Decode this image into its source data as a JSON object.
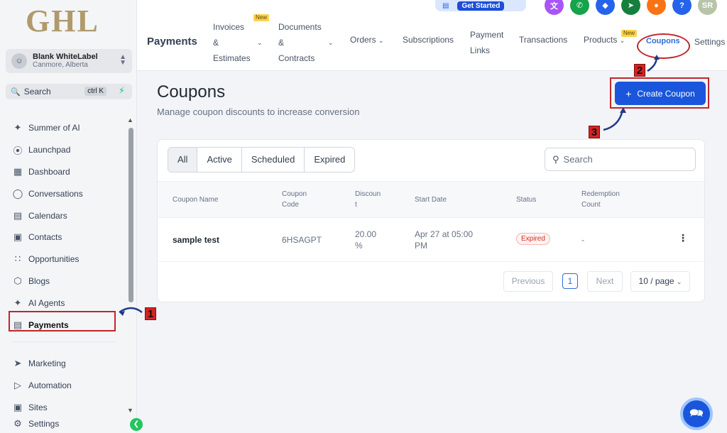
{
  "sidebar": {
    "logo": "GHL",
    "account": {
      "name": "Blank WhiteLabel",
      "location": "Canmore, Alberta"
    },
    "search": {
      "label": "Search",
      "shortcut": "ctrl K"
    },
    "items": [
      {
        "label": "Summer of AI",
        "icon": "sparkle-icon"
      },
      {
        "label": "Launchpad",
        "icon": "rocket-icon"
      },
      {
        "label": "Dashboard",
        "icon": "grid-icon"
      },
      {
        "label": "Conversations",
        "icon": "chat-icon"
      },
      {
        "label": "Calendars",
        "icon": "calendar-icon"
      },
      {
        "label": "Contacts",
        "icon": "contacts-icon"
      },
      {
        "label": "Opportunities",
        "icon": "opportunities-icon"
      },
      {
        "label": "Blogs",
        "icon": "box-icon"
      },
      {
        "label": "AI Agents",
        "icon": "sparkle-icon"
      },
      {
        "label": "Payments",
        "icon": "receipt-icon"
      }
    ],
    "items2": [
      {
        "label": "Marketing",
        "icon": "send-icon"
      },
      {
        "label": "Automation",
        "icon": "automation-icon"
      },
      {
        "label": "Sites",
        "icon": "sites-icon"
      },
      {
        "label": "Settings",
        "icon": "gear-icon"
      }
    ]
  },
  "topbar": {
    "get_started": "Get Started",
    "title": "Payments",
    "nav": {
      "invoices": [
        "Invoices",
        "&",
        "Estimates"
      ],
      "documents": [
        "Documents",
        "&",
        "Contracts"
      ],
      "orders": "Orders",
      "subscriptions": "Subscriptions",
      "payment_links": [
        "Payment",
        "Links"
      ],
      "transactions": "Transactions",
      "products": "Products",
      "coupons": "Coupons",
      "settings": "Settings"
    },
    "new_badge": "New",
    "user_initials": "SR",
    "help_icon_text": "?"
  },
  "main": {
    "title": "Coupons",
    "subtitle": "Manage coupon discounts to increase conversion",
    "create_button": "Create Coupon",
    "filters": [
      "All",
      "Active",
      "Scheduled",
      "Expired"
    ],
    "search_placeholder": "Search",
    "columns": [
      [
        "Coupon Name"
      ],
      [
        "Coupon",
        "Code"
      ],
      [
        "Discoun",
        "t"
      ],
      [
        "Start Date"
      ],
      [
        "Status"
      ],
      [
        "Redemption",
        "Count"
      ]
    ],
    "rows": [
      {
        "name": "sample test",
        "code": "6HSAGPT",
        "discount": [
          "20.00",
          "%"
        ],
        "start_date": [
          "Apr 27 at 05:00",
          "PM"
        ],
        "status": "Expired",
        "redemption": "-"
      }
    ],
    "pagination": {
      "previous": "Previous",
      "page": "1",
      "next": "Next",
      "page_size": "10 / page"
    }
  },
  "annotations": [
    "1",
    "2",
    "3"
  ],
  "colors": {
    "primary": "#1a56db",
    "annotation": "#c0262d",
    "expired": "#d92d20"
  }
}
